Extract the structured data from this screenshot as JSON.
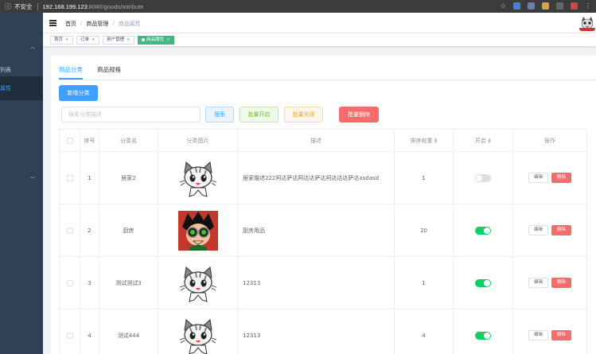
{
  "browser": {
    "info_icon": "info-icon",
    "insecure": "不安全",
    "url_host": "192.168.199.123",
    "url_path": ":8080/goods/attribute"
  },
  "sidebar": {
    "items": [
      {
        "label": "",
        "has_arrow": true
      },
      {
        "label": "列表",
        "active": false
      },
      {
        "label": "属性",
        "active": true
      },
      {
        "label": "",
        "has_arrow": false
      },
      {
        "label": "",
        "has_arrow": true
      }
    ]
  },
  "breadcrumb": [
    "首页",
    "商品管理",
    "商品属性"
  ],
  "tags": [
    {
      "label": "首页",
      "active": false
    },
    {
      "label": "订单",
      "active": false
    },
    {
      "label": "用户管理",
      "active": false
    },
    {
      "label": "商品属性",
      "active": true
    }
  ],
  "tabs": [
    {
      "label": "商品分类",
      "active": true
    },
    {
      "label": "商品规格",
      "active": false
    }
  ],
  "toolbar": {
    "add_label": "新增分类",
    "search_placeholder": "搜索分类描述",
    "search_label": "搜索",
    "batch_open_label": "批量开启",
    "batch_close_label": "批量关闭",
    "batch_delete_label": "批量删除"
  },
  "table": {
    "headers": {
      "index": "序号",
      "name": "分类名",
      "image": "分类图片",
      "desc": "描述",
      "weight": "排序权重",
      "enabled": "开启",
      "ops": "操作"
    },
    "rows": [
      {
        "index": "1",
        "name": "居家2",
        "image": "cat-cartoon",
        "desc": "居家描述222阿达萨达阿达达萨达阿达达达萨达asdasd",
        "weight": "1",
        "enabled": false
      },
      {
        "index": "2",
        "name": "厨房",
        "image": "anime-avatar",
        "desc": "厨房用品",
        "weight": "20",
        "enabled": true
      },
      {
        "index": "3",
        "name": "测试测试3",
        "image": "cat-cartoon",
        "desc": "12313",
        "weight": "1",
        "enabled": true
      },
      {
        "index": "4",
        "name": "测试444",
        "image": "cat-cartoon",
        "desc": "12313",
        "weight": "4",
        "enabled": true
      }
    ],
    "edit_label": "编辑",
    "delete_label": "删除"
  },
  "colors": {
    "sidebar_bg": "#304156",
    "primary": "#409eff",
    "tag_active": "#42b983",
    "danger": "#f56c6c",
    "switch_on": "#13ce66"
  }
}
